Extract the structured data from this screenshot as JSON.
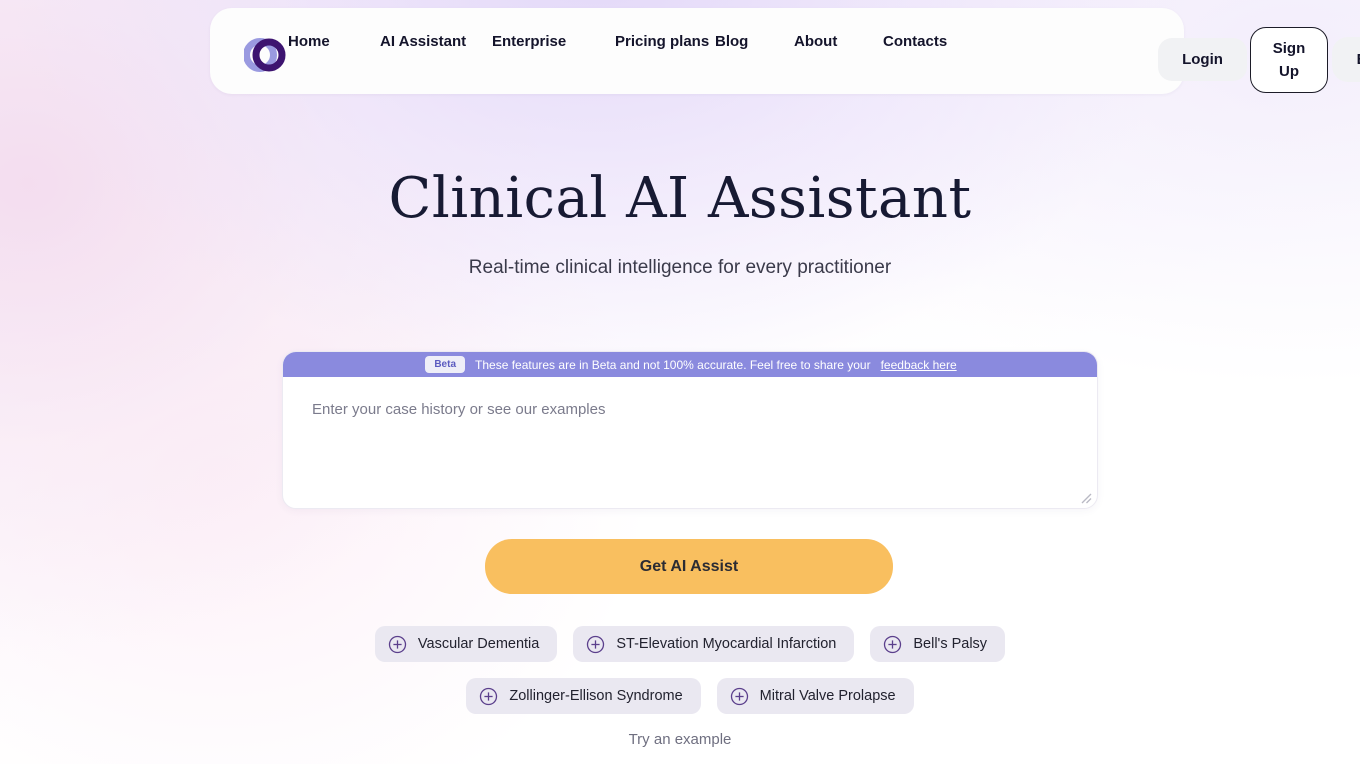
{
  "brand": {
    "logo_icon": "overlapping-rings-logo",
    "logo_color_light": "#9a9ae0",
    "logo_color_dark": "#3d1470"
  },
  "nav": {
    "links": [
      {
        "label": "Home"
      },
      {
        "label": "AI Assistant"
      },
      {
        "label": "Enterprise"
      },
      {
        "label": "Pricing plans"
      },
      {
        "label": "Blog"
      },
      {
        "label": "About"
      },
      {
        "label": "Contacts"
      }
    ],
    "login_label": "Login",
    "signup_label": "Sign Up",
    "language_code": "EN",
    "language_icon": "globe-icon"
  },
  "hero": {
    "title": "Clinical AI Assistant",
    "subtitle": "Real-time clinical intelligence for every practitioner"
  },
  "beta": {
    "badge": "Beta",
    "message": "These features are in Beta and not 100% accurate. Feel free to share your",
    "link_label": "feedback here",
    "banner_color": "#8a8ade"
  },
  "case_form": {
    "placeholder": "Enter your case history or see our examples",
    "value": "",
    "resize_handle_icon": "resize-grip-icon"
  },
  "cta": {
    "label": "Get AI Assist",
    "color": "#f9bf5f"
  },
  "examples": {
    "chips": [
      {
        "label": "Vascular Dementia",
        "icon": "plus-circle-icon"
      },
      {
        "label": "ST-Elevation Myocardial Infarction",
        "icon": "plus-circle-icon"
      },
      {
        "label": "Bell's Palsy",
        "icon": "plus-circle-icon"
      },
      {
        "label": "Zollinger-Ellison Syndrome",
        "icon": "plus-circle-icon"
      },
      {
        "label": "Mitral Valve Prolapse",
        "icon": "plus-circle-icon"
      }
    ],
    "caption": "Try an example",
    "chip_bg": "#eae8f1",
    "chip_icon_color": "#5b3f8c"
  }
}
